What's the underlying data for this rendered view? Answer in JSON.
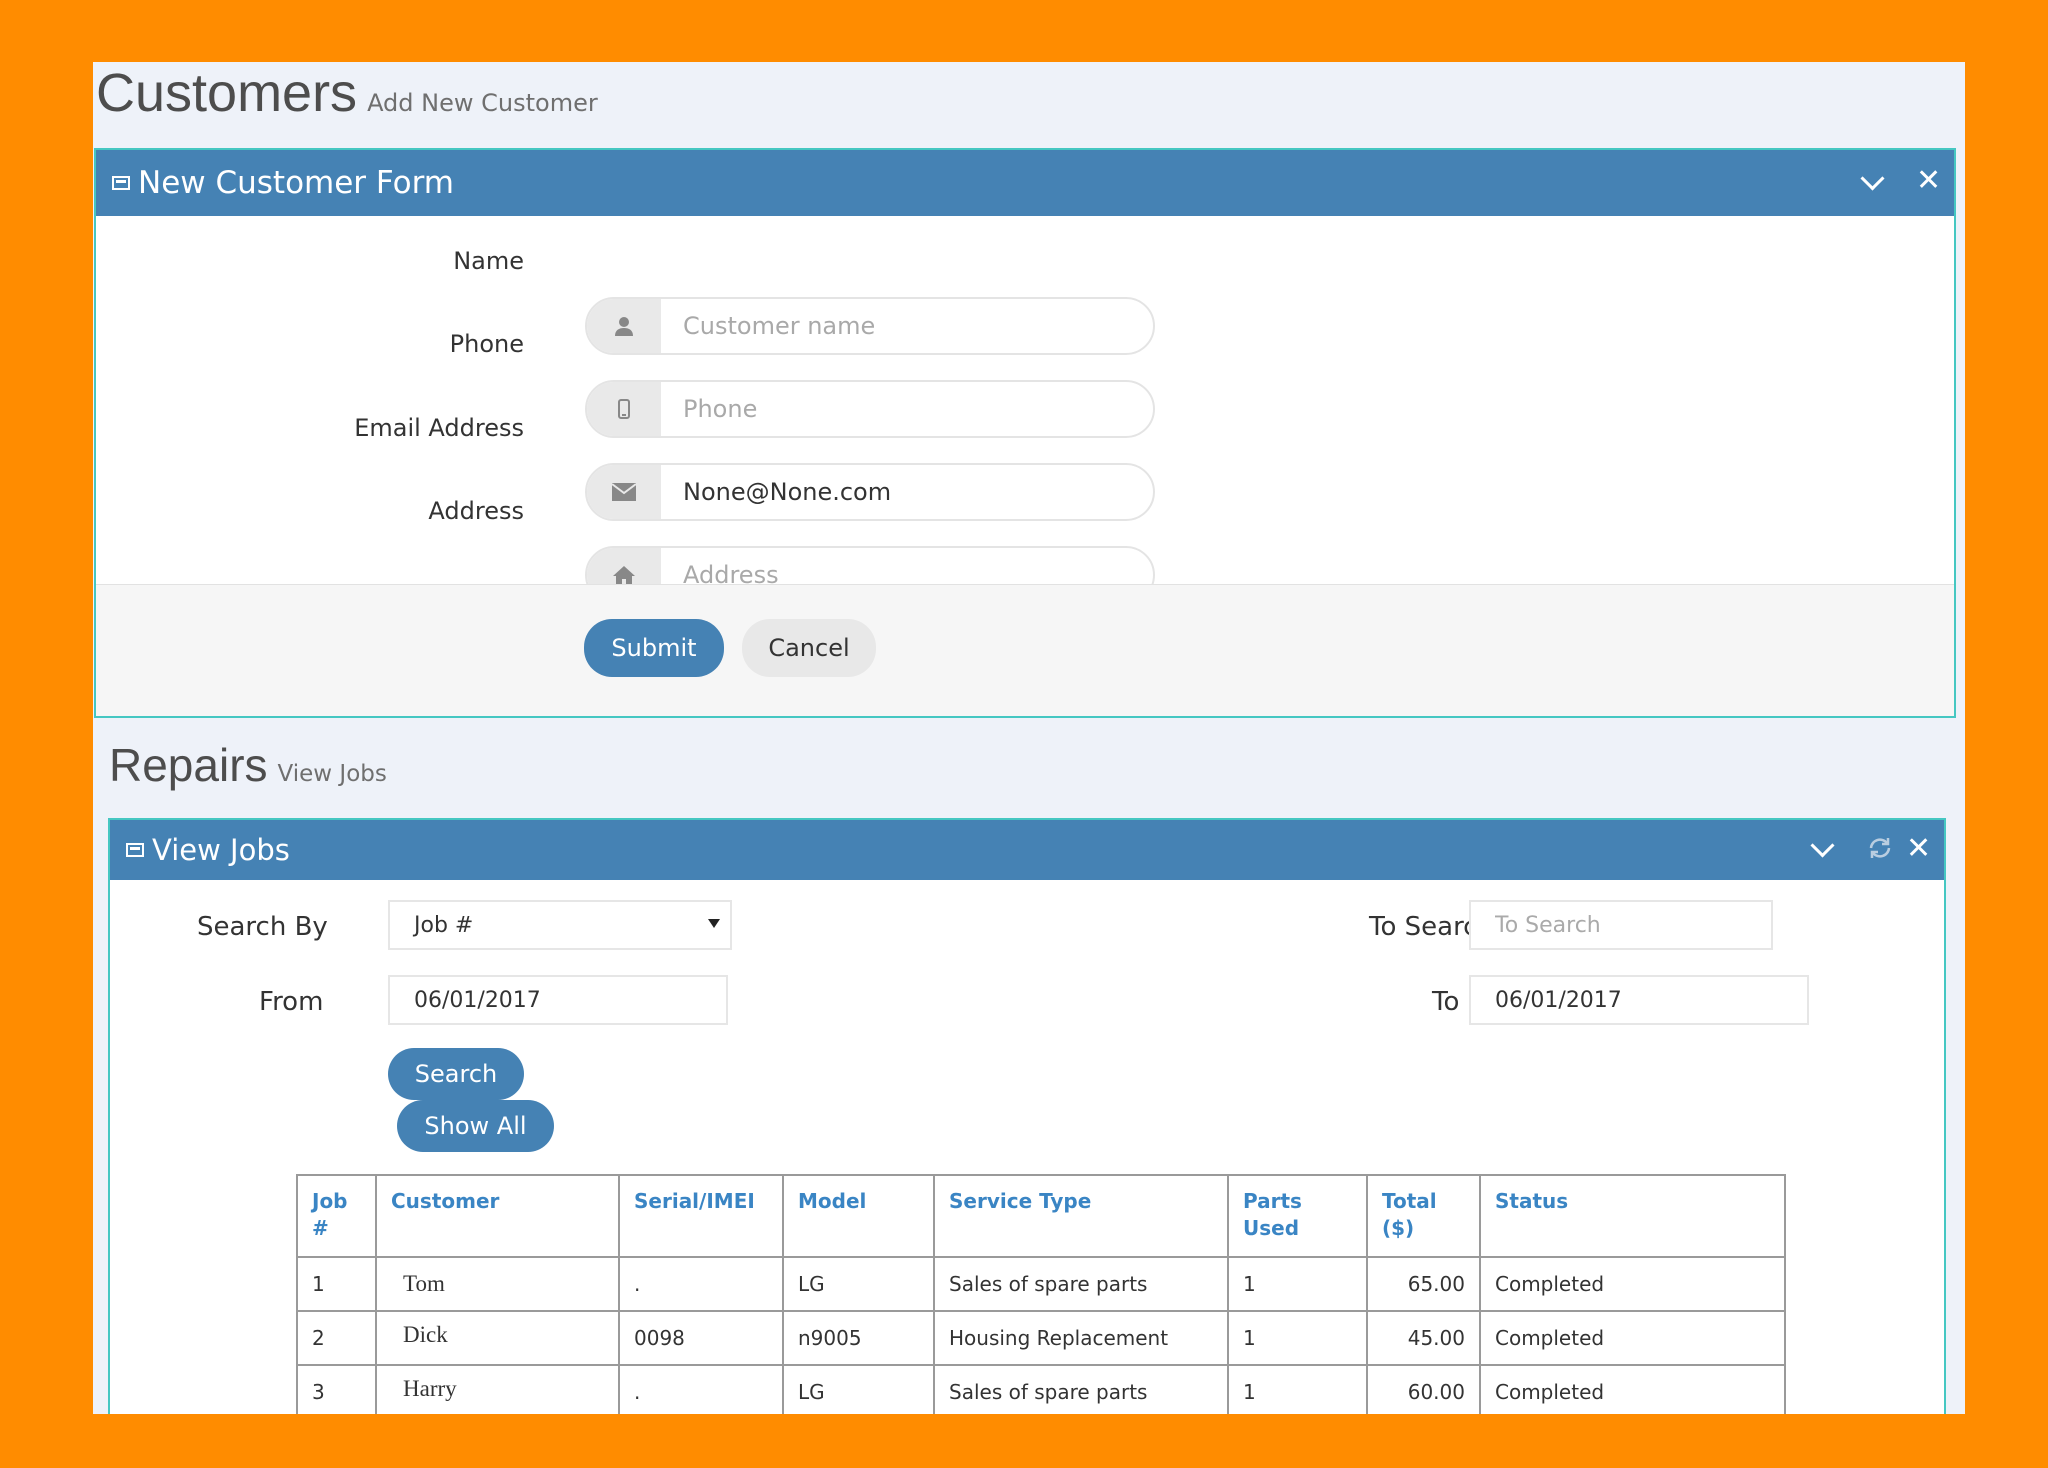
{
  "customers_header": {
    "title": "Customers",
    "subtitle": "Add New Customer"
  },
  "customer_form": {
    "title": "New Customer Form",
    "fields": {
      "name": {
        "label": "Name",
        "placeholder": "Customer name",
        "value": ""
      },
      "phone": {
        "label": "Phone",
        "placeholder": "Phone",
        "value": ""
      },
      "email": {
        "label": "Email Address",
        "placeholder": "",
        "value": "None@None.com"
      },
      "address": {
        "label": "Address",
        "placeholder": "Address",
        "value": ""
      }
    },
    "submit_label": "Submit",
    "cancel_label": "Cancel"
  },
  "repairs_header": {
    "title": "Repairs",
    "subtitle": "View Jobs"
  },
  "jobs_panel": {
    "title": "View Jobs",
    "search_by": {
      "label": "Search By",
      "selected": "Job #"
    },
    "to_search": {
      "label": "To Search",
      "placeholder": "To Search"
    },
    "from": {
      "label": "From",
      "value": "06/01/2017"
    },
    "to": {
      "label": "To",
      "value": "06/01/2017"
    },
    "search_label": "Search",
    "show_all_label": "Show All",
    "table": {
      "headers": [
        "Job\n#",
        "Customer",
        "Serial/IMEI",
        "Model",
        "Service Type",
        "Parts\nUsed",
        "Total\n($)",
        "Status"
      ],
      "rows": [
        [
          "1",
          "Tom",
          ".",
          "LG",
          "Sales of spare parts",
          "1",
          "65.00",
          "Completed"
        ],
        [
          "2",
          "Dick",
          "0098",
          "n9005",
          "Housing Replacement",
          "1",
          "45.00",
          "Completed"
        ],
        [
          "3",
          "Harry",
          ".",
          "LG",
          "Sales of spare parts",
          "1",
          "60.00",
          "Completed"
        ]
      ]
    }
  },
  "icons": {
    "name": "user-icon",
    "phone": "mobile-icon",
    "email": "envelope-icon",
    "address": "home-icon",
    "panel": "window-icon",
    "collapse": "chevron-down-icon",
    "close": "close-icon",
    "refresh": "refresh-icon"
  },
  "colors": {
    "accent": "#4582b4",
    "frame": "#ff8c00",
    "panel_border": "#45c7c2",
    "table_header_text": "#3a85c4"
  }
}
